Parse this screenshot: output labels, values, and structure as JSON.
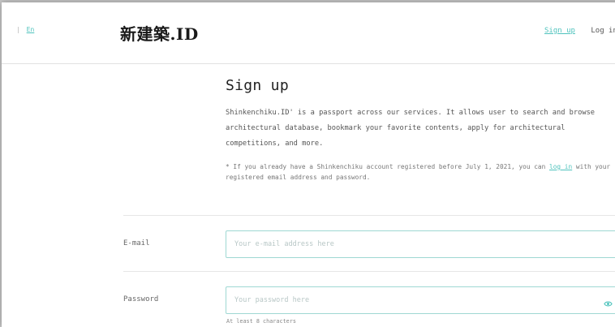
{
  "header": {
    "language_separator": "|",
    "language": "En",
    "logo": "新建築.ID",
    "nav": {
      "signup": "Sign up",
      "login": "Log in"
    }
  },
  "main": {
    "title": "Sign up",
    "intro": "Shinkenchiku.ID' is a passport across our services. It allows user to search and browse architectural database, bookmark your favorite contents, apply for architectural competitions, and more.",
    "note_prefix": "* If you already have a Shinkenchiku account registered before July 1, 2021, you can ",
    "note_link": "log in",
    "note_suffix": " with your registered email address and password."
  },
  "form": {
    "email": {
      "label": "E-mail",
      "placeholder": "Your e-mail address here",
      "value": ""
    },
    "password": {
      "label": "Password",
      "placeholder": "Your password here",
      "value": "",
      "hint": "At least 8 characters"
    }
  },
  "colors": {
    "accent": "#4fc3bd",
    "input_border": "#9fd8d3"
  },
  "icons": {
    "password_toggle": "eye-icon"
  }
}
